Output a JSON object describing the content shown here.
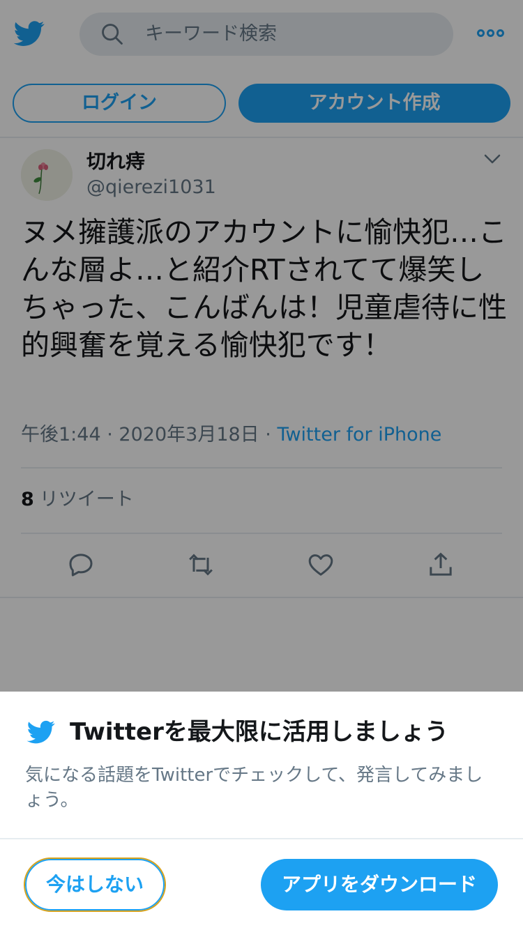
{
  "colors": {
    "accent": "#1da1f2",
    "secondary_text": "#657786",
    "primary_text": "#14171a"
  },
  "header": {
    "logo_icon": "twitter-bird-icon",
    "search": {
      "placeholder": "キーワード検索",
      "icon": "search-icon"
    },
    "more_icon": "more-icon"
  },
  "auth": {
    "login_label": "ログイン",
    "signup_label": "アカウント作成"
  },
  "tweet": {
    "author_name": "切れ痔",
    "author_handle": "@qierezi1031",
    "text": "ヌメ擁護派のアカウントに愉快犯…こんな層よ…と紹介RTされてて爆笑しちゃった、こんばんは！児童虐待に性的興奮を覚える愉快犯です！",
    "time": "午後1:44",
    "date": "2020年3月18日",
    "separator": "·",
    "source": "Twitter for iPhone",
    "retweet_count": "8",
    "retweet_label": "リツイート",
    "actions": [
      "reply-icon",
      "retweet-icon",
      "like-icon",
      "share-icon"
    ]
  },
  "sheet": {
    "title": "Twitterを最大限に活用しましょう",
    "description": "気になる話題をTwitterでチェックして、発言してみましょう。",
    "not_now_label": "今はしない",
    "download_label": "アプリをダウンロード"
  }
}
